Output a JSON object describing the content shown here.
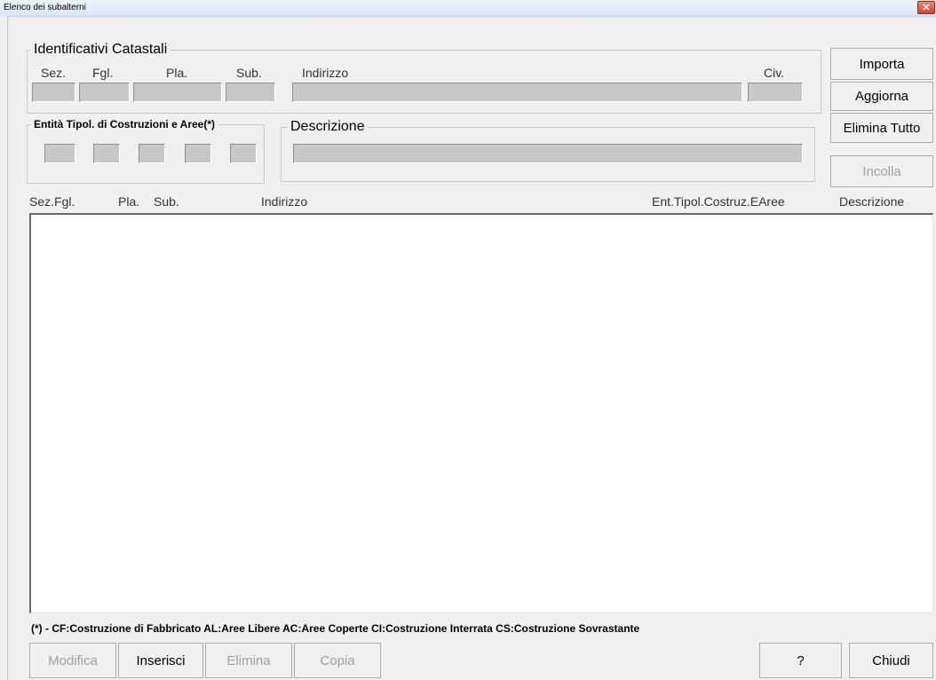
{
  "window": {
    "title": "Elenco dei subalterni",
    "close_glyph": "✕"
  },
  "identificativi": {
    "legend": "Identificativi Catastali",
    "labels": {
      "sez": "Sez.",
      "fgl": "Fgl.",
      "pla": "Pla.",
      "sub": "Sub.",
      "indirizzo": "Indirizzo",
      "civ": "Civ."
    }
  },
  "entita": {
    "legend": "Entità Tipol. di Costruzioni e Aree(*)"
  },
  "descrizione": {
    "legend": "Descrizione"
  },
  "side_buttons": {
    "importa": "Importa",
    "aggiorna": "Aggiorna",
    "elimina_tutto": "Elimina Tutto",
    "incolla": "Incolla"
  },
  "list": {
    "headers": {
      "sez_fgl": "Sez.Fgl.",
      "pla": "Pla.",
      "sub": "Sub.",
      "indirizzo": "Indirizzo",
      "ent": "Ent.Tipol.Costruz.EAree",
      "descrizione": "Descrizione"
    },
    "rows": []
  },
  "legend_note": "(*) - CF:Costruzione di Fabbricato   AL:Aree Libere   AC:Aree Coperte   CI:Costruzione Interrata   CS:Costruzione Sovrastante",
  "bottom_buttons": {
    "modifica": "Modifica",
    "inserisci": "Inserisci",
    "elimina": "Elimina",
    "copia": "Copia",
    "help": "?",
    "chiudi": "Chiudi"
  }
}
